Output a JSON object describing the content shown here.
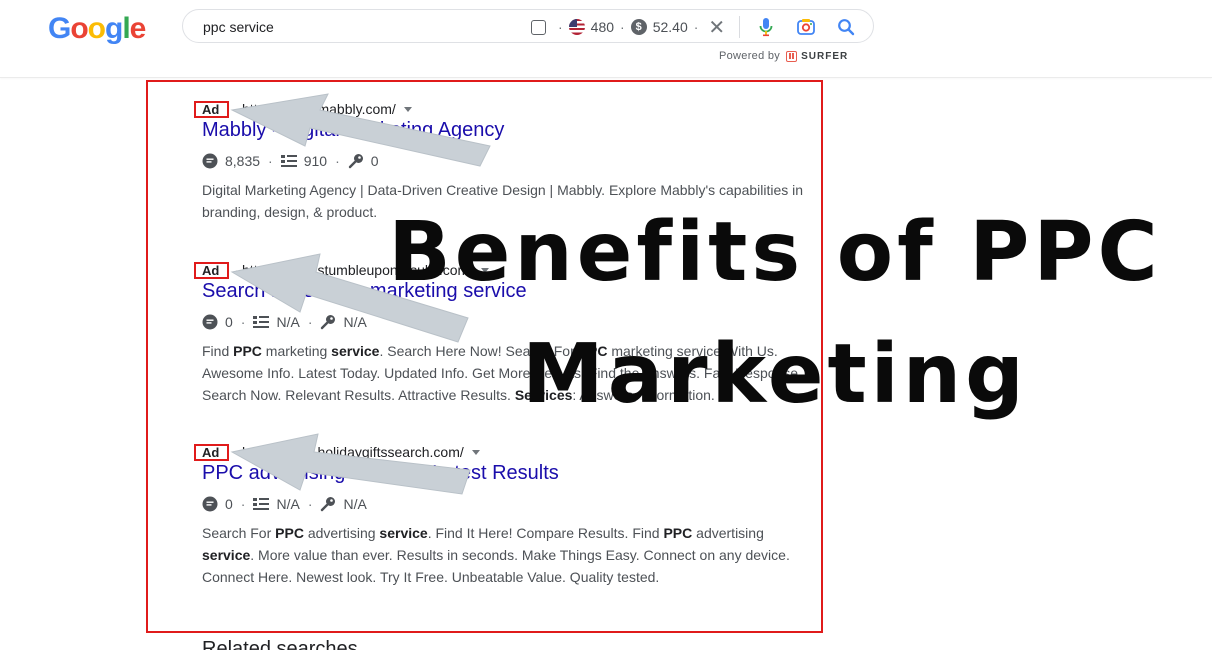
{
  "logo": {
    "text": "Google",
    "letters": [
      "G",
      "o",
      "o",
      "g",
      "l",
      "e"
    ]
  },
  "search": {
    "query": "ppc service",
    "volume": "480",
    "cpc": "52.40",
    "powered_by": "Powered by",
    "surfer": "SURFER"
  },
  "ads": [
    {
      "label": "Ad",
      "url": "https://www.mabbly.com/",
      "title": "Mabbly - Digital Marketing Agency",
      "m1": "8,835",
      "m2": "910",
      "m3": "0",
      "desc": [
        {
          "t": "Digital Marketing Agency | Data-Driven Creative Design | Mabbly. Explore Mabbly's capabilities in branding, design, & product.",
          "b": false
        }
      ]
    },
    {
      "label": "Ad",
      "url": "https://www.stumbleuponresults.com/",
      "title": "Search Here - ppc marketing service",
      "m1": "0",
      "m2": "N/A",
      "m3": "N/A",
      "desc": [
        {
          "t": "Find ",
          "b": false
        },
        {
          "t": "PPC",
          "b": true
        },
        {
          "t": " marketing ",
          "b": false
        },
        {
          "t": "service",
          "b": true
        },
        {
          "t": ". Search Here Now! Search For ",
          "b": false
        },
        {
          "t": "PPC",
          "b": true
        },
        {
          "t": " marketing service With Us. Awesome Info. Latest Today. Updated Info. Get More Results. Find the Answers. Fast Response. Search Now. Relevant Results. Attractive Results. ",
          "b": false
        },
        {
          "t": "Services",
          "b": true
        },
        {
          "t": ": Answers, Information.",
          "b": false
        }
      ]
    },
    {
      "label": "Ad",
      "url": "https://www.holidaygiftssearch.com/",
      "title": "PPC advertising service - Latest Results",
      "m1": "0",
      "m2": "N/A",
      "m3": "N/A",
      "desc": [
        {
          "t": "Search For ",
          "b": false
        },
        {
          "t": "PPC",
          "b": true
        },
        {
          "t": " advertising ",
          "b": false
        },
        {
          "t": "service",
          "b": true
        },
        {
          "t": ". Find It Here! Compare Results. Find ",
          "b": false
        },
        {
          "t": "PPC",
          "b": true
        },
        {
          "t": " advertising ",
          "b": false
        },
        {
          "t": "service",
          "b": true
        },
        {
          "t": ". More value than ever. Results in seconds. Make Things Easy. Connect on any device. Connect Here. Newest look. Try It Free. Unbeatable Value. Quality tested.",
          "b": false
        }
      ]
    }
  ],
  "related": "Related searches",
  "headline": {
    "line1": "Benefits of PPC",
    "line2": "Marketing"
  },
  "colors": {
    "frame": "#e01b1b",
    "link": "#1a0dab",
    "arrow": "#c9d0d6"
  }
}
